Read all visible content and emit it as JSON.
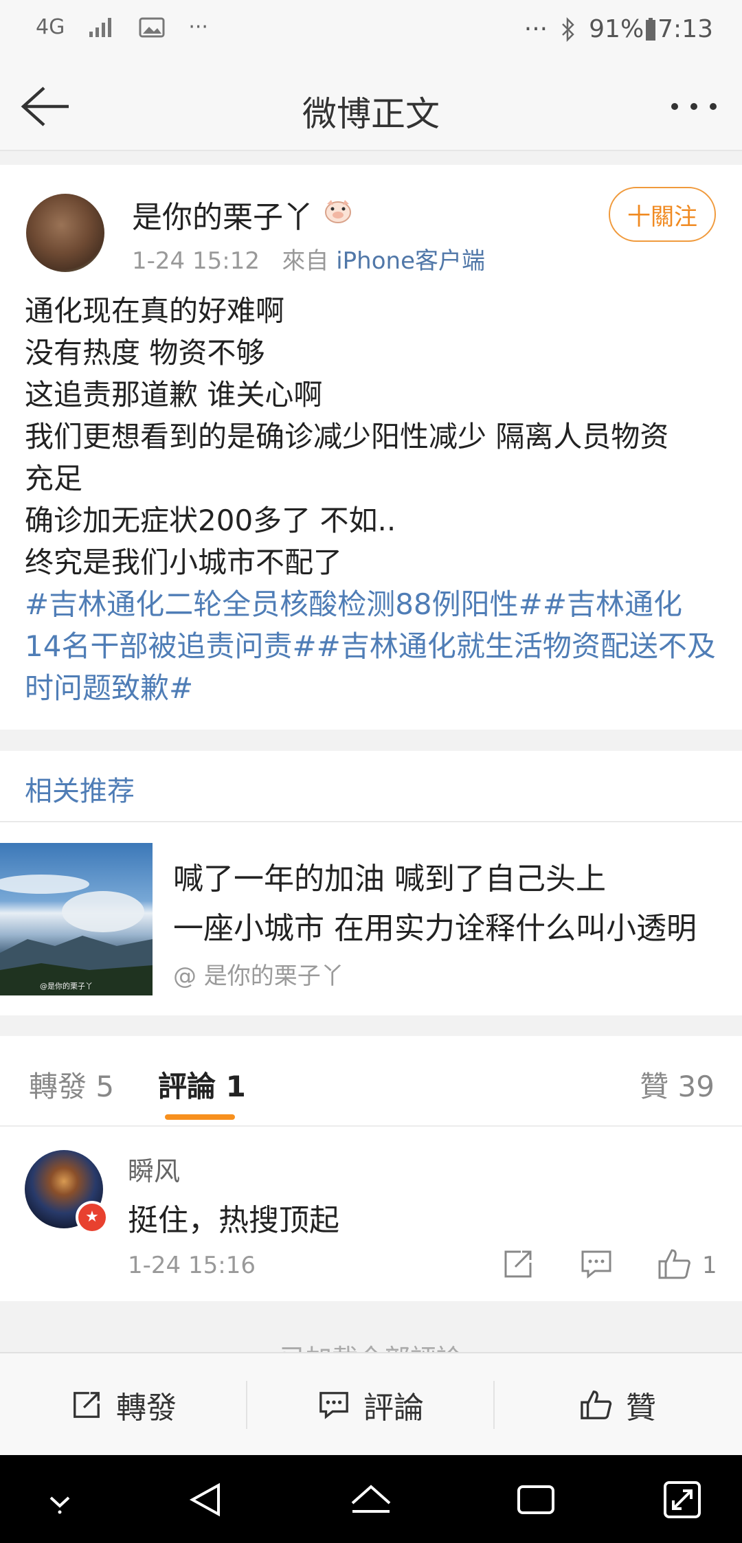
{
  "status_bar": {
    "network": "4G",
    "dots_left": "···",
    "dots_right": "···",
    "battery": "91%",
    "time": "7:13"
  },
  "header": {
    "title": "微博正文",
    "icons": [
      "back-arrow-icon",
      "more-dots-icon"
    ]
  },
  "post": {
    "username": "是你的栗子丫",
    "time": "1-24 15:12",
    "source_prefix": "來自",
    "source": "iPhone客户端",
    "follow_label": "十關注",
    "lines": [
      "通化现在真的好难啊",
      "没有热度 物资不够",
      "这追责那道歉 谁关心啊",
      "我们更想看到的是确诊减少阳性减少 隔离人员物资",
      "充足",
      "确诊加无症状200多了 不如..",
      "终究是我们小城市不配了"
    ],
    "hashtags": "#吉林通化二轮全员核酸检测88例阳性##吉林通化14名干部被追责问责##吉林通化就生活物资配送不及时问题致歉#"
  },
  "related": {
    "title": "相关推荐",
    "line1": "喊了一年的加油 喊到了自己头上",
    "line2": "一座小城市 在用实力诠释什么叫小透明",
    "author": "@ 是你的栗子丫",
    "thumb_watermark": "@是你的栗子丫"
  },
  "tabs": {
    "repost": "轉發 5",
    "comment": "評論 1",
    "like": "贊 39"
  },
  "comment": {
    "name": "瞬风",
    "text": "挺住，热搜顶起",
    "time": "1-24 15:16",
    "like_count": "1"
  },
  "loaded_text": "已加載全部評論",
  "action_bar": {
    "repost": "轉發",
    "comment": "評論",
    "like": "贊"
  },
  "colors": {
    "link_blue": "#4f7db6",
    "accent_orange": "#f7901e"
  }
}
